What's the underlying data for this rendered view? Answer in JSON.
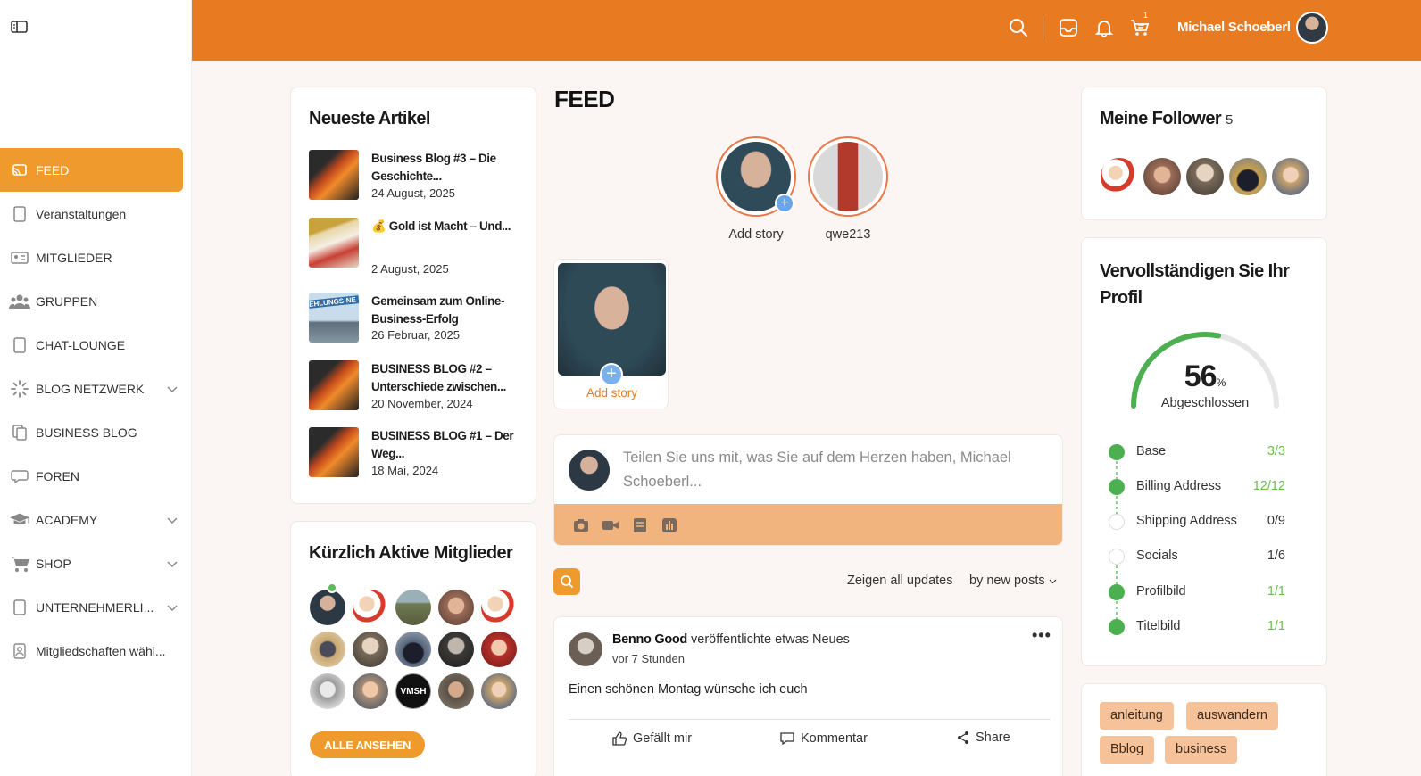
{
  "topbar": {
    "user_name": "Michael Schoeberl",
    "cart_count": "1"
  },
  "sidebar": {
    "items": [
      {
        "label": "FEED",
        "active": true,
        "icon": "cast-icon"
      },
      {
        "label": "Veranstaltungen",
        "icon": "page-icon"
      },
      {
        "label": "MITGLIEDER",
        "icon": "id-card-icon"
      },
      {
        "label": "GRUPPEN",
        "icon": "users-icon"
      },
      {
        "label": "CHAT-LOUNGE",
        "icon": "page-icon"
      },
      {
        "label": "BLOG NETZWERK",
        "icon": "spinner-icon",
        "expandable": true
      },
      {
        "label": "BUSINESS BLOG",
        "icon": "copy-icon"
      },
      {
        "label": "FOREN",
        "icon": "chat-bubble-icon"
      },
      {
        "label": "ACADEMY",
        "icon": "graduation-cap-icon",
        "expandable": true
      },
      {
        "label": "SHOP",
        "icon": "cart-icon",
        "expandable": true
      },
      {
        "label": "UNTERNEHMERLI...",
        "icon": "page-icon",
        "expandable": true
      },
      {
        "label": "Mitgliedschaften wähl...",
        "icon": "member-card-icon"
      }
    ]
  },
  "articles": {
    "title": "Neueste Artikel",
    "items": [
      {
        "title": "Business Blog #3 – Die Geschichte...",
        "date": "24 August, 2025"
      },
      {
        "title_emoji": "💰",
        "title": "Gold ist Macht – Und...",
        "date": "2 August, 2025"
      },
      {
        "title": "Gemeinsam zum Online-Business-Erfolg",
        "date": "26 Februar, 2025",
        "thumb_text": "EHLUNGS-NE"
      },
      {
        "title": "BUSINESS BLOG #2 – Unterschiede zwischen...",
        "date": "20 November, 2024"
      },
      {
        "title": "BUSINESS BLOG #1 – Der Weg...",
        "date": "18 Mai, 2024"
      }
    ]
  },
  "members": {
    "title": "Kürzlich Aktive Mitglieder",
    "button": "ALLE ANSEHEN",
    "logo_text": "VMSH"
  },
  "feed": {
    "title": "FEED",
    "stories": [
      {
        "label": "Add story"
      },
      {
        "label": "qwe213"
      }
    ],
    "story_card_label": "Add story",
    "composer_placeholder": "Teilen Sie uns mit, was Sie auf dem Herzen haben, Michael Schoeberl...",
    "filter_show": "Zeigen all updates",
    "filter_sort": "by new posts",
    "post": {
      "author": "Benno Good",
      "action": "veröffentlichte etwas Neues",
      "time": "vor 7 Stunden",
      "body": "Einen schönen Montag wünsche ich euch",
      "like": "Gefällt mir",
      "comment": "Kommentar",
      "share": "Share"
    }
  },
  "followers": {
    "title": "Meine Follower",
    "count": "5"
  },
  "profile": {
    "title": "Vervollständigen Sie Ihr Profil",
    "percent": 56,
    "percent_sign": "%",
    "done_label": "Abgeschlossen",
    "items": [
      {
        "label": "Base",
        "value": "3/3",
        "complete": true
      },
      {
        "label": "Billing Address",
        "value": "12/12",
        "complete": true
      },
      {
        "label": "Shipping Address",
        "value": "0/9",
        "complete": false
      },
      {
        "label": "Socials",
        "value": "1/6",
        "complete": false
      },
      {
        "label": "Profilbild",
        "value": "1/1",
        "complete": true
      },
      {
        "label": "Titelbild",
        "value": "1/1",
        "complete": true
      }
    ]
  },
  "tags": [
    "anleitung",
    "auswandern",
    "Bblog",
    "business"
  ],
  "colors": {
    "brand": "#e87a22",
    "accent": "#ee9a2c",
    "tag_bg": "#f6c299",
    "success": "#4caf50"
  }
}
